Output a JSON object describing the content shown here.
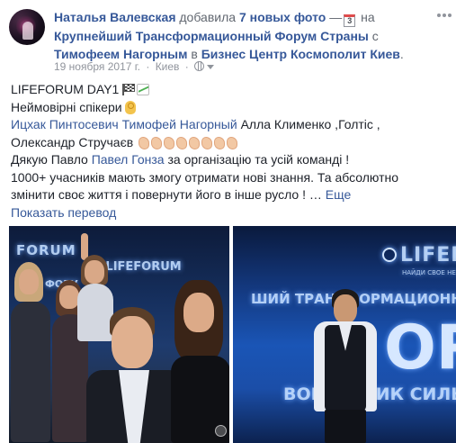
{
  "post": {
    "author": "Наталья Валевская",
    "action": "добавила",
    "photos_count_link": "7 новых фото",
    "dash": "—",
    "calendar_day": "3",
    "at_word": "на",
    "event_link": "Крупнейший Трансформационный Форум Страны",
    "with_word": "с",
    "tagged_person": "Тимофеем Нагорным",
    "in_word": "в",
    "location_link": "Бизнес Центр Космополит Киев",
    "period": ".",
    "date": "19 ноября 2017 г.",
    "separator": "·",
    "city": "Киев",
    "separator2": "·"
  },
  "body": {
    "line1_text": "LIFEFORUM DAY1",
    "line2_text": "Неймовірні спікери",
    "line3_link1": "Ицхак Пинтосевич",
    "line3_link2": "Тимофей Нагорный",
    "line3_rest": "Алла Клименко ,Голтіс ,",
    "line4_text": "Олександр Стручаєв",
    "line5_prefix": "Дякую Павло",
    "line5_link": "Павел Гонза",
    "line5_suffix": "за організацію та усій команді !",
    "line6_text": "1000+ учасників мають змогу отримати нові знання. Та абсолютно",
    "line7_text": "змінити своє життя і повернути його в інше русло ! …",
    "more_link": "Еще",
    "translate_link": "Показать перевод"
  },
  "icons": {
    "flag": "chequered-flag-icon",
    "chart": "chart-increasing-icon",
    "ok": "ok-hand-icon",
    "clap": "clapping-hands-icon",
    "globe": "globe-icon",
    "caret": "caret-down-icon",
    "more": "more-options-icon",
    "calendar": "calendar-icon"
  },
  "photos": {
    "left_sign_text": "FORUM",
    "left_sign_hashtag": "# LIFEFORUM",
    "left_sign_fragment": "ФОРУ",
    "right_logo": "LIFEFORUM",
    "right_subtitle": "НАЙДИ СВОЕ НЕЧТО",
    "right_banner": "ШИЙ ТРАНСФОРМАЦИОННЫЙ Ф",
    "right_big": "OR",
    "right_bottom": "ВОЙ ИСТ   ИК СИЛЫ И"
  },
  "colors": {
    "link": "#365899",
    "meta": "#90949c",
    "text": "#1d2129"
  }
}
